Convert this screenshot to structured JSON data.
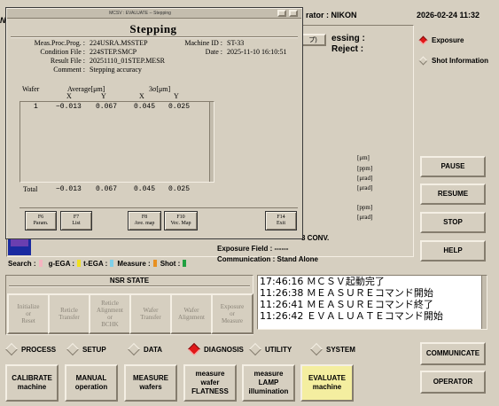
{
  "topbar": {
    "logo": "Ni",
    "operator_label": "rator : NIKON",
    "datetime": "2026-02-24 11:32"
  },
  "background_panel": {
    "tab_suffix": "プ)",
    "status_line1": "essing :",
    "status_line2": "Reject :",
    "units": [
      "[μm]",
      "[ppm]",
      "[μrad]",
      "[μrad]",
      "[ppm]",
      "[μrad]"
    ],
    "conv_suffix": "3 CONV.",
    "exposure_field": "Exposure Field :  ------",
    "communication": "Communication : Stand Alone"
  },
  "right_options": [
    {
      "label": "Exposure",
      "selected": true
    },
    {
      "label": "Shot Information",
      "selected": false
    }
  ],
  "control_buttons": [
    "PAUSE",
    "RESUME",
    "STOP",
    "HELP"
  ],
  "legend": {
    "search": "Search :",
    "g_ega": "g-EGA :",
    "t_ega": "t-EGA :",
    "measure": "Measure :",
    "shot": "Shot :",
    "colors": {
      "search": "#f4b4c0",
      "g_ega": "#f0e020",
      "t_ega": "#7fd0e8",
      "measure": "#e89020",
      "shot": "#20a040"
    }
  },
  "nsr_state": {
    "title": "NSR STATE",
    "buttons": [
      "Initialize\nor\nReset",
      "Reticle\nTransfer",
      "Reticle\nAlignment\nor\nBCHK",
      "Wafer\nTransfer",
      "Wafer\nAlignment",
      "Exposure\nor\nMeasure"
    ]
  },
  "log": [
    "17:46:16 ＭＣＳＶ起動完了",
    "11:26:38 ＭＥＡＳＵＲＥコマンド開始",
    "11:26:41 ＭＥＡＳＵＲＥコマンド終了",
    "11:26:42 ＥＶＡＬＵＡＴＥコマンド開始"
  ],
  "nav_tabs": [
    {
      "label": "PROCESS",
      "selected": false
    },
    {
      "label": "SETUP",
      "selected": false
    },
    {
      "label": "DATA",
      "selected": false
    },
    {
      "label": "DIAGNOSIS",
      "selected": true
    },
    {
      "label": "UTILITY",
      "selected": false
    },
    {
      "label": "SYSTEM",
      "selected": false
    }
  ],
  "machine_buttons": [
    "CALIBRATE\nmachine",
    "MANUAL\noperation",
    "MEASURE\nwafers",
    "measure\nwafer\nFLATNESS",
    "measure\nLAMP\nillumination",
    "EVALUATE\nmachine"
  ],
  "side_buttons": [
    "COMMUNICATE",
    "OPERATOR"
  ],
  "dialog": {
    "window_title": "MCSV : EVALUATE -- Stepping",
    "heading": "Stepping",
    "info_left": {
      "labels": [
        "Meas.Proc.Prog. :",
        "Condition File :",
        "Result File :",
        "Comment :"
      ],
      "values": [
        "224USRA.MSSTEP",
        "224STEP.SMCP",
        "20251110_01STEP.MESR",
        "Stepping accuracy"
      ]
    },
    "info_right": {
      "labels": [
        "Machine ID :",
        "Date :"
      ],
      "values": [
        "ST-33",
        "2025-11-10 16:10:51"
      ]
    },
    "table": {
      "col_wafer": "Wafer",
      "col_average": "Average[μm]",
      "col_3sigma": "3σ[μm]",
      "sub_x": "X",
      "sub_y": "Y",
      "rows": [
        {
          "wafer": "1",
          "avg_x": "−0.013",
          "avg_y": "0.067",
          "s_x": "0.045",
          "s_y": "0.025"
        }
      ],
      "total": {
        "label": "Total",
        "avg_x": "−0.013",
        "avg_y": "0.067",
        "s_x": "0.045",
        "s_y": "0.025"
      }
    },
    "fkeys": [
      "F6\nParam.",
      "F7\nList",
      "F8\nAve. map",
      "F10\nVec. Map",
      "F14\nExit"
    ]
  }
}
